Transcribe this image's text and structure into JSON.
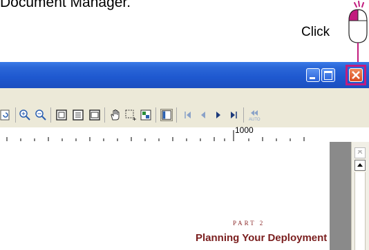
{
  "caption": "Document Manager.",
  "callout": {
    "label": "Click"
  },
  "window": {
    "controls": {
      "minimize": "minimize",
      "maximize": "maximize",
      "close": "close"
    }
  },
  "ruler": {
    "label": "1000"
  },
  "document": {
    "part_label": "PART 2",
    "heading": "Planning Your Deployment"
  },
  "colors": {
    "titlebar": "#1e58cf",
    "close_button": "#e2532f",
    "highlight": "#c21c7e",
    "heading": "#7a1e1e"
  }
}
